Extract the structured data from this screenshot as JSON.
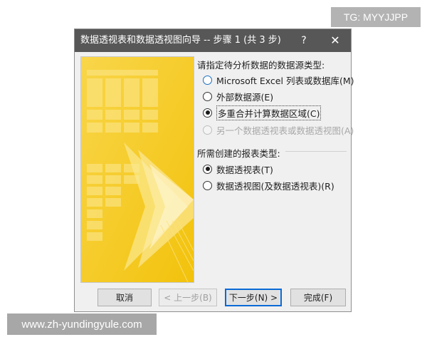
{
  "badge": {
    "text": "TG: MYYJJPP"
  },
  "watermark": {
    "text": "www.zh-yundingyule.com"
  },
  "dialog": {
    "title": "数据透视表和数据透视图向导 -- 步骤 1 (共 3 步)",
    "help_label": "?",
    "close_label": "✕",
    "source_group": {
      "label": "请指定待分析数据的数据源类型:",
      "options": [
        {
          "label": "Microsoft Excel 列表或数据库(M)",
          "checked": false,
          "disabled": false
        },
        {
          "label": "外部数据源(E)",
          "checked": false,
          "disabled": false
        },
        {
          "label": "多重合并计算数据区域(C)",
          "checked": true,
          "disabled": false
        },
        {
          "label": "另一个数据透视表或数据透视图(A)",
          "checked": false,
          "disabled": true
        }
      ]
    },
    "report_group": {
      "label": "所需创建的报表类型:",
      "options": [
        {
          "label": "数据透视表(T)",
          "checked": true,
          "disabled": false
        },
        {
          "label": "数据透视图(及数据透视表)(R)",
          "checked": false,
          "disabled": false
        }
      ]
    },
    "buttons": {
      "cancel": "取消",
      "back": "< 上一步(B)",
      "next": "下一步(N) >",
      "finish": "完成(F)"
    }
  },
  "colors": {
    "titlebar": "#575757",
    "art_yellow": "#f6cc16",
    "accent_blue": "#0a6ad6"
  }
}
